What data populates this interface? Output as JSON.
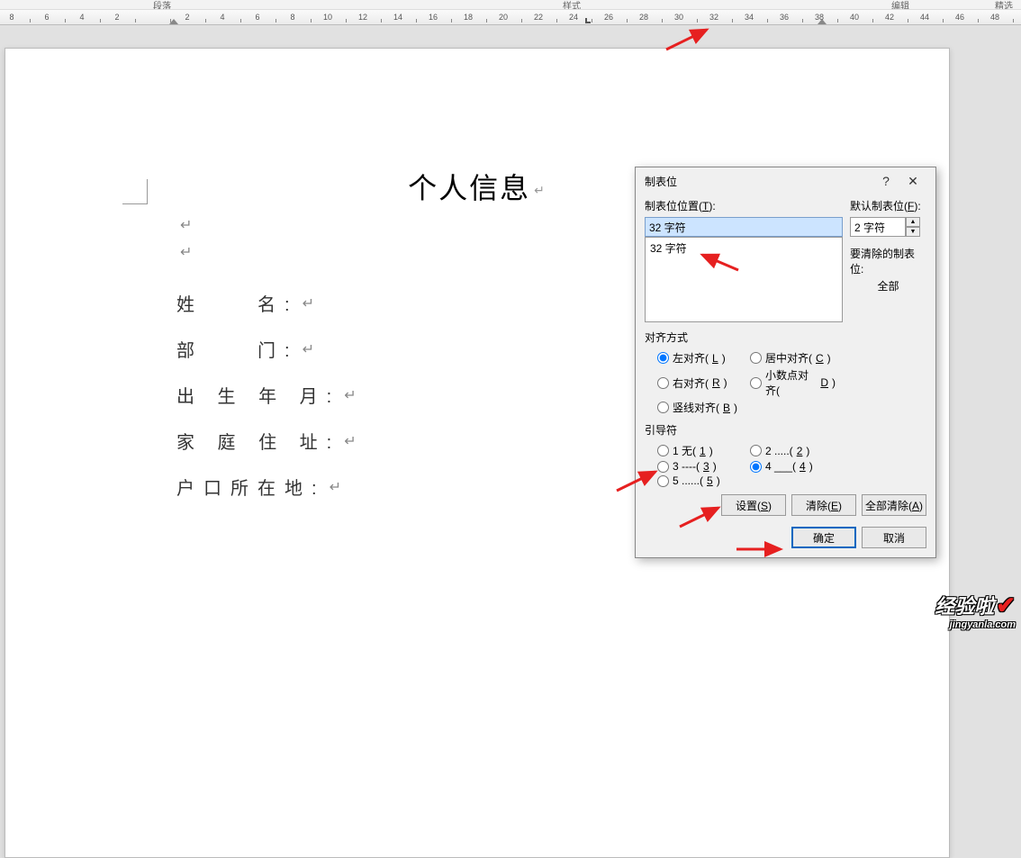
{
  "toolbar": {
    "group_paragraph": "段落",
    "group_style": "样式",
    "group_edit": "编辑",
    "group_clipboard": "精选"
  },
  "ruler": {
    "marks": [
      "8",
      "6",
      "4",
      "2",
      "",
      "2",
      "4",
      "6",
      "8",
      "10",
      "12",
      "14",
      "16",
      "18",
      "20",
      "22",
      "24",
      "26",
      "28",
      "30",
      "32",
      "34",
      "36",
      "38",
      "40",
      "42",
      "44",
      "46",
      "48"
    ]
  },
  "document": {
    "title": "个人信息",
    "enter": "↵",
    "lines": [
      "姓　　名:",
      "部　　门:",
      "出 生 年 月:",
      "家 庭 住 址:",
      "户口所在地:"
    ]
  },
  "dialog": {
    "title": "制表位",
    "tab_pos_label": "制表位位置(T):",
    "default_label": "默认制表位(F):",
    "input_value": "32 字符",
    "list_item": "32 字符",
    "default_value": "2 字符",
    "clear_label": "要清除的制表位:",
    "clear_all_label": "全部",
    "align_group": "对齐方式",
    "align_left": "左对齐(L)",
    "align_center": "居中对齐(C)",
    "align_right": "右对齐(R)",
    "align_decimal": "小数点对齐(D)",
    "align_bar": "竖线对齐(B)",
    "leader_group": "引导符",
    "leader_1": "1 无(1)",
    "leader_2": "2 .....(2)",
    "leader_3": "3 ----(3)",
    "leader_4": "4 ___(4)",
    "leader_5": "5 ......(5)",
    "set_btn": "设置(S)",
    "clear_btn": "清除(E)",
    "clear_all_btn": "全部清除(A)",
    "ok_btn": "确定",
    "cancel_btn": "取消"
  },
  "watermark": {
    "brand": "经验啦",
    "url": "jingyanla.com"
  }
}
